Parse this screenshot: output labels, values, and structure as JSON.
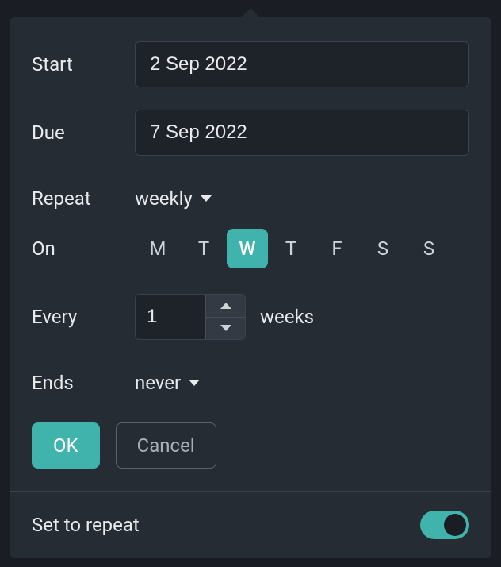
{
  "start": {
    "label": "Start",
    "value": "2 Sep 2022"
  },
  "due": {
    "label": "Due",
    "value": "7 Sep 2022"
  },
  "repeat": {
    "label": "Repeat",
    "value": "weekly"
  },
  "on": {
    "label": "On",
    "days": [
      "M",
      "T",
      "W",
      "T",
      "F",
      "S",
      "S"
    ],
    "selected_index": 2
  },
  "every": {
    "label": "Every",
    "value": "1",
    "unit": "weeks"
  },
  "ends": {
    "label": "Ends",
    "value": "never"
  },
  "actions": {
    "ok": "OK",
    "cancel": "Cancel"
  },
  "footer": {
    "label": "Set to repeat",
    "toggle_on": true
  },
  "colors": {
    "accent": "#3fb3ac"
  }
}
